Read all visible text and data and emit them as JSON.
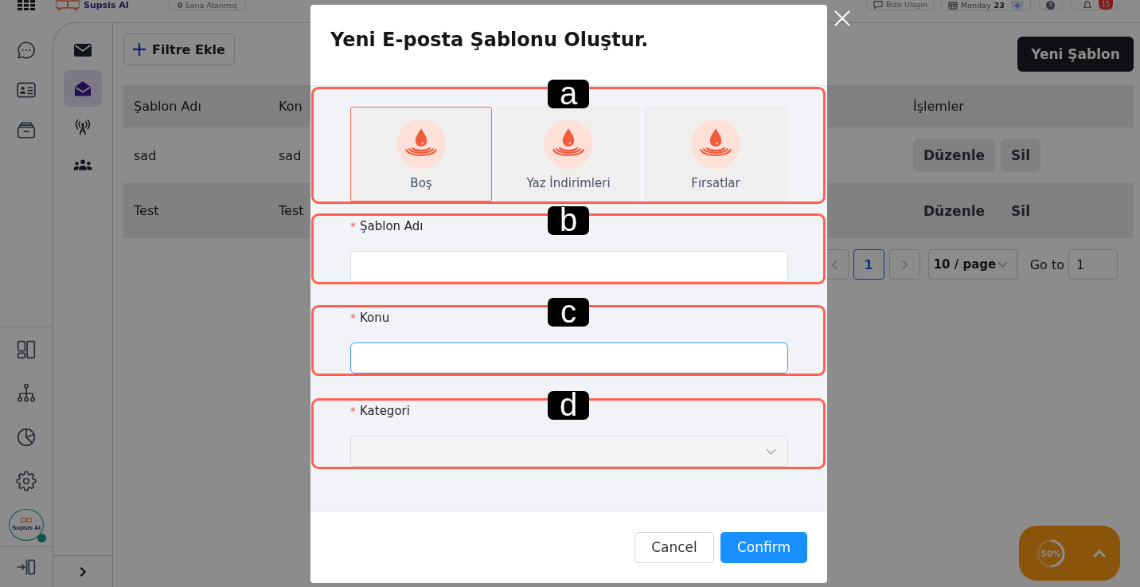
{
  "top_bar": {
    "logo": "Supsis AI",
    "assigned": "**0** Sana Atanmış",
    "contact": "Bize Ulaşın",
    "date": {
      "day": "Monday",
      "number": "23"
    },
    "notifications": "15"
  },
  "rail": {
    "avatar_label": "Supsis AI",
    "online": true
  },
  "subnav": {
    "items": [
      {
        "selected": false
      },
      {
        "selected": true
      },
      {
        "selected": false
      },
      {
        "selected": false
      }
    ]
  },
  "toolbar": {
    "filter_button": "Filtre Ekle",
    "new_button": "Yeni Şablon"
  },
  "table": {
    "columns": [
      "Şablon Adı",
      "Kon",
      "İşlemler"
    ],
    "rows": [
      {
        "cells": [
          "sad",
          "sad"
        ],
        "actions": [
          "Düzenle",
          "Sil"
        ],
        "hovered": false
      },
      {
        "cells": [
          "Test",
          "Test"
        ],
        "actions": [
          "Düzenle",
          "Sil"
        ],
        "hovered": true
      }
    ]
  },
  "pagination": {
    "pages": [
      {
        "label": "1",
        "selected": true
      }
    ],
    "page_size": "10 / page",
    "goto_label": "Go to",
    "goto_value": "1"
  },
  "scroll_widget": {
    "reading": "50%",
    "level": 0.5
  },
  "modal": {
    "title": "Yeni E-posta Şablonu Oluştur.",
    "sections": [
      {
        "annotation": "a",
        "kind": "templates",
        "templates": [
          {
            "label": "Boş",
            "selected": true
          },
          {
            "label": "Yaz İndirimleri",
            "selected": false
          },
          {
            "label": "Fırsatlar",
            "selected": false
          }
        ]
      },
      {
        "annotation": "b",
        "kind": "field",
        "field": {
          "kind": "input",
          "label": "Şablon Adı",
          "required_mark": "*",
          "focused": false
        }
      },
      {
        "annotation": "c",
        "kind": "field",
        "field": {
          "kind": "input",
          "label": "Konu",
          "required_mark": "*",
          "focused": true
        }
      },
      {
        "annotation": "d",
        "kind": "field",
        "field": {
          "kind": "select",
          "label": "Kategori",
          "required_mark": "*",
          "focused": false
        }
      }
    ],
    "buttons": [
      {
        "label": "Cancel",
        "kind": "default"
      },
      {
        "label": "Confirm",
        "kind": "primary"
      }
    ]
  }
}
